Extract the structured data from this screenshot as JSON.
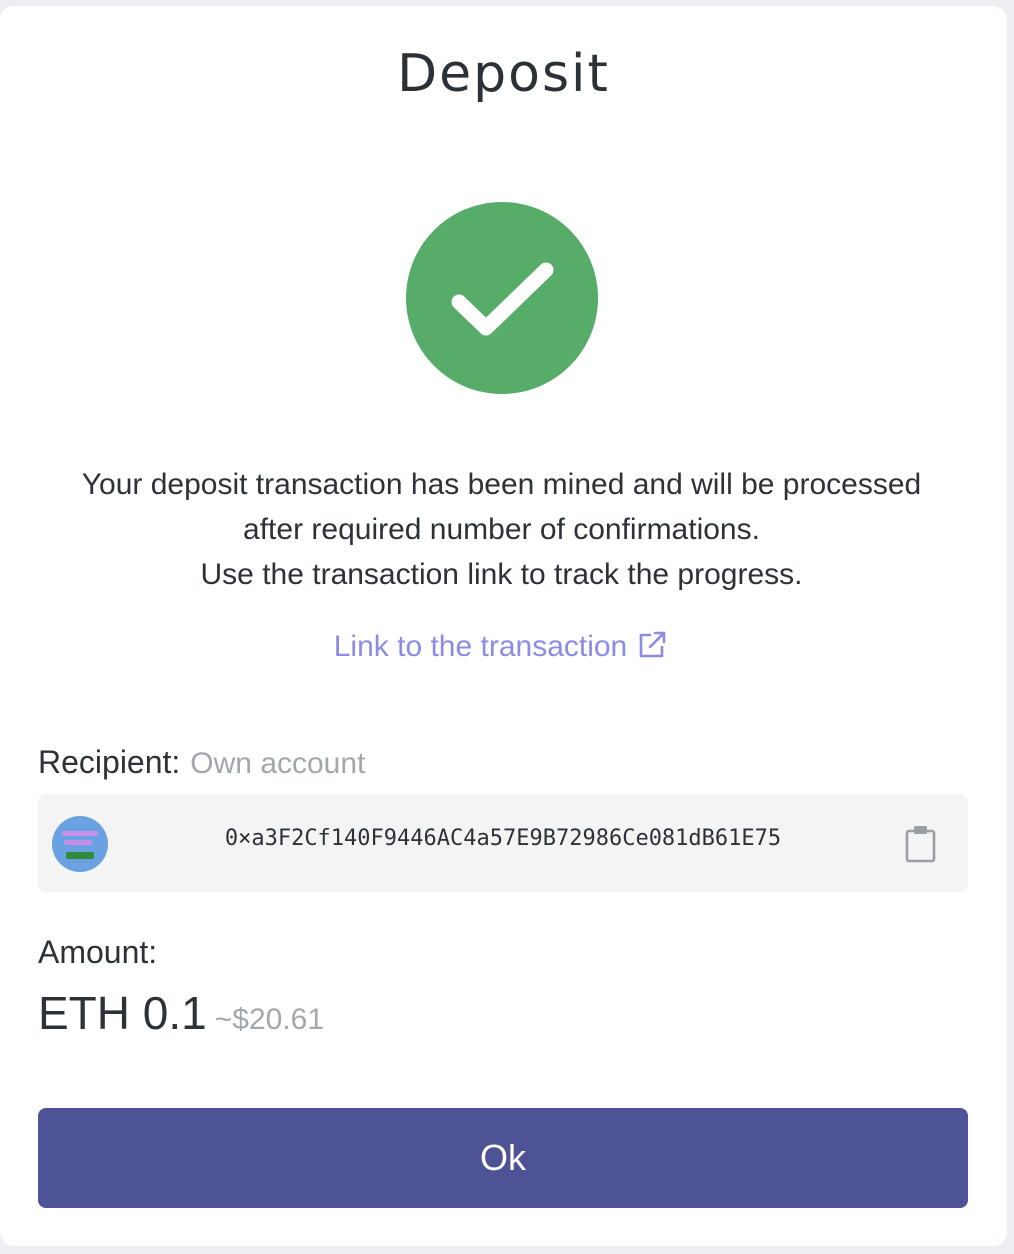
{
  "modal": {
    "title": "Deposit",
    "status_icon": "check-circle-icon",
    "accent_color": "#58ac69"
  },
  "message": {
    "lines": [
      "Your deposit transaction has been mined and will be processed",
      "after required number of confirmations.",
      "Use the transaction link to track the progress."
    ]
  },
  "transaction_link": {
    "label": "Link to the transaction",
    "icon": "external-link-icon",
    "color": "#8d8ce5"
  },
  "recipient": {
    "label": "Recipient:",
    "note": "Own account",
    "address": "0×a3F2Cf140F9446AC4a57E9B72986Ce081dB61E75",
    "copy_icon": "clipboard-icon"
  },
  "amount": {
    "label": "Amount:",
    "value": "ETH 0.1",
    "fiat": "~$20.61"
  },
  "actions": {
    "ok_label": "Ok",
    "button_color": "#4e5395"
  }
}
